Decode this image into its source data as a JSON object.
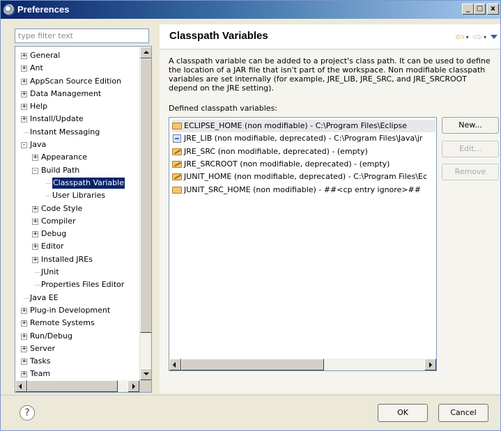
{
  "window": {
    "title": "Preferences",
    "controls": {
      "minimize": "_",
      "maximize": "□",
      "close": "x"
    }
  },
  "filter": {
    "placeholder": "type filter text"
  },
  "tree": {
    "items": [
      {
        "label": "General",
        "expander": "+"
      },
      {
        "label": "Ant",
        "expander": "+"
      },
      {
        "label": "AppScan Source Edition",
        "expander": "+"
      },
      {
        "label": "Data Management",
        "expander": "+"
      },
      {
        "label": "Help",
        "expander": "+"
      },
      {
        "label": "Install/Update",
        "expander": "+"
      },
      {
        "label": "Instant Messaging",
        "expander": ""
      },
      {
        "label": "Java",
        "expander": "-"
      },
      {
        "label": "Appearance",
        "expander": "+"
      },
      {
        "label": "Build Path",
        "expander": "-"
      },
      {
        "label": "Classpath Variable",
        "expander": "",
        "selected": true
      },
      {
        "label": "User Libraries",
        "expander": ""
      },
      {
        "label": "Code Style",
        "expander": "+"
      },
      {
        "label": "Compiler",
        "expander": "+"
      },
      {
        "label": "Debug",
        "expander": "+"
      },
      {
        "label": "Editor",
        "expander": "+"
      },
      {
        "label": "Installed JREs",
        "expander": "+"
      },
      {
        "label": "JUnit",
        "expander": ""
      },
      {
        "label": "Properties Files Editor",
        "expander": ""
      },
      {
        "label": "Java EE",
        "expander": ""
      },
      {
        "label": "Plug-in Development",
        "expander": "+"
      },
      {
        "label": "Remote Systems",
        "expander": "+"
      },
      {
        "label": "Run/Debug",
        "expander": "+"
      },
      {
        "label": "Server",
        "expander": "+"
      },
      {
        "label": "Tasks",
        "expander": "+"
      },
      {
        "label": "Team",
        "expander": "+"
      }
    ]
  },
  "main": {
    "title": "Classpath Variables",
    "nav": {
      "back": "⇦",
      "forward": "⇨",
      "dropdown": "▾"
    },
    "description": "A classpath variable can be added to a project's class path. It can be used to define the location of a JAR file that isn't part of the workspace. Non modifiable classpath variables are set internally (for example, JRE_LIB, JRE_SRC, and JRE_SRCROOT depend on the JRE setting).",
    "defined_label": "Defined classpath variables:",
    "variables": [
      {
        "text": "ECLIPSE_HOME (non modifiable) - C:\\Program Files\\Eclipse",
        "icon": "folder-icon",
        "selected": true
      },
      {
        "text": "JRE_LIB (non modifiable, deprecated) - C:\\Program Files\\Java\\jr",
        "icon": "jar-icon"
      },
      {
        "text": "JRE_SRC (non modifiable, deprecated) - (empty)",
        "icon": "deprecated-folder-icon"
      },
      {
        "text": "JRE_SRCROOT (non modifiable, deprecated) - (empty)",
        "icon": "deprecated-folder-icon"
      },
      {
        "text": "JUNIT_HOME (non modifiable, deprecated) - C:\\Program Files\\Ec",
        "icon": "deprecated-folder-icon"
      },
      {
        "text": "JUNIT_SRC_HOME (non modifiable) - ##<cp entry ignore>##",
        "icon": "folder-icon"
      }
    ],
    "buttons": {
      "new": "New...",
      "edit": "Edit...",
      "remove": "Remove"
    }
  },
  "footer": {
    "help": "?",
    "ok": "OK",
    "cancel": "Cancel"
  }
}
